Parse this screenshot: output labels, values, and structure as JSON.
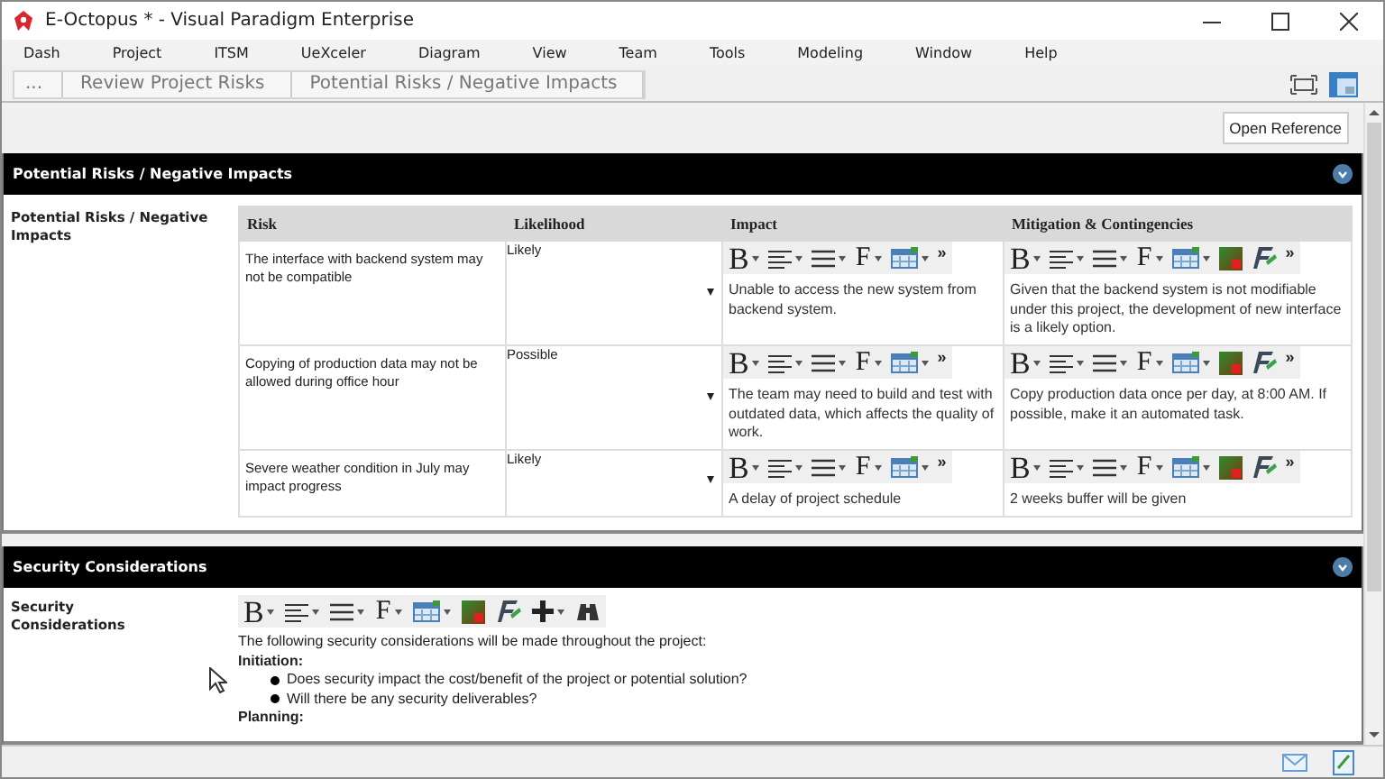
{
  "window": {
    "title": "E-Octopus * - Visual Paradigm Enterprise"
  },
  "menu": [
    "Dash",
    "Project",
    "ITSM",
    "UeXceler",
    "Diagram",
    "View",
    "Team",
    "Tools",
    "Modeling",
    "Window",
    "Help"
  ],
  "breadcrumb": [
    "...",
    "Review Project Risks",
    "Potential Risks / Negative Impacts"
  ],
  "open_reference": "Open Reference",
  "sections": [
    {
      "kind": "table",
      "title": "Potential Risks / Negative Impacts",
      "label": "Potential Risks / Negative Impacts",
      "table": {
        "columns": [
          "Risk",
          "Likelihood",
          "Impact",
          "Mitigation & Contingencies"
        ],
        "rows": [
          {
            "risk": "The interface with backend system may not be compatible",
            "likelihood": "Likely",
            "impact": {
              "toolbar": [
                {
                  "kind": "bold",
                  "label": "B"
                },
                {
                  "kind": "align"
                },
                {
                  "kind": "list"
                },
                {
                  "kind": "font",
                  "label": "F"
                },
                {
                  "kind": "table"
                },
                {
                  "kind": "more",
                  "label": "»"
                }
              ],
              "text": "Unable to access the new system from backend system."
            },
            "mitigation": {
              "toolbar": [
                {
                  "kind": "bold",
                  "label": "B"
                },
                {
                  "kind": "align"
                },
                {
                  "kind": "list"
                },
                {
                  "kind": "font",
                  "label": "F"
                },
                {
                  "kind": "table"
                },
                {
                  "kind": "color"
                },
                {
                  "kind": "format"
                },
                {
                  "kind": "more",
                  "label": "»"
                }
              ],
              "text": "Given that the backend system is not modifiable under this project, the development of new interface is a likely option."
            }
          },
          {
            "risk": "Copying of production data may not be allowed during office hour",
            "likelihood": "Possible",
            "impact": {
              "toolbar": [
                {
                  "kind": "bold",
                  "label": "B"
                },
                {
                  "kind": "align"
                },
                {
                  "kind": "list"
                },
                {
                  "kind": "font",
                  "label": "F"
                },
                {
                  "kind": "table"
                },
                {
                  "kind": "more",
                  "label": "»"
                }
              ],
              "text": "The team may need to build and test with outdated data, which affects the quality of work."
            },
            "mitigation": {
              "toolbar": [
                {
                  "kind": "bold",
                  "label": "B"
                },
                {
                  "kind": "align"
                },
                {
                  "kind": "list"
                },
                {
                  "kind": "font",
                  "label": "F"
                },
                {
                  "kind": "table"
                },
                {
                  "kind": "color"
                },
                {
                  "kind": "format"
                },
                {
                  "kind": "more",
                  "label": "»"
                }
              ],
              "text": "Copy production data once per day, at 8:00 AM. If possible, make it an automated task."
            }
          },
          {
            "risk": "Severe weather condition in July may impact progress",
            "likelihood": "Likely",
            "impact": {
              "toolbar": [
                {
                  "kind": "bold",
                  "label": "B"
                },
                {
                  "kind": "align"
                },
                {
                  "kind": "list"
                },
                {
                  "kind": "font",
                  "label": "F"
                },
                {
                  "kind": "table"
                },
                {
                  "kind": "more",
                  "label": "»"
                }
              ],
              "text": "A delay of project schedule"
            },
            "mitigation": {
              "toolbar": [
                {
                  "kind": "bold",
                  "label": "B"
                },
                {
                  "kind": "align"
                },
                {
                  "kind": "list"
                },
                {
                  "kind": "font",
                  "label": "F"
                },
                {
                  "kind": "table"
                },
                {
                  "kind": "color"
                },
                {
                  "kind": "format"
                },
                {
                  "kind": "more",
                  "label": "»"
                }
              ],
              "text": "2 weeks buffer will be given"
            }
          }
        ]
      }
    },
    {
      "kind": "richtext",
      "title": "Security Considerations",
      "label": "Security Considerations",
      "toolbar": [
        {
          "kind": "bold",
          "label": "B"
        },
        {
          "kind": "align"
        },
        {
          "kind": "list"
        },
        {
          "kind": "font",
          "label": "F"
        },
        {
          "kind": "table"
        },
        {
          "kind": "color"
        },
        {
          "kind": "format"
        },
        {
          "kind": "insert"
        },
        {
          "kind": "find"
        }
      ],
      "content": [
        {
          "kind": "paragraph",
          "text": "The following security considerations will be made throughout the project:"
        },
        {
          "kind": "heading",
          "text": "Initiation:"
        },
        {
          "kind": "bullet",
          "text": "Does security impact the cost/benefit of the project or potential solution?"
        },
        {
          "kind": "bullet",
          "text": "Will there be any security deliverables?"
        },
        {
          "kind": "heading",
          "text": "Planning:"
        }
      ]
    }
  ]
}
